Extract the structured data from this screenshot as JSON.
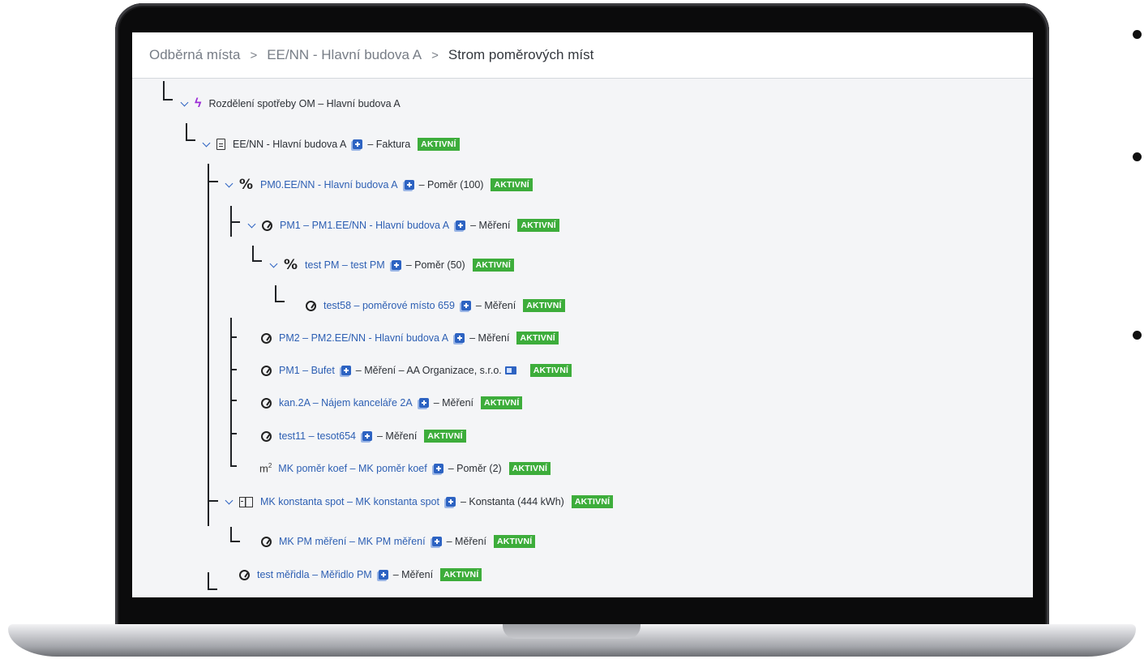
{
  "breadcrumb": [
    {
      "label": "Odběrná místa"
    },
    {
      "label": "EE/NN - Hlavní budova A"
    },
    {
      "label": "Strom poměrových míst"
    }
  ],
  "breadcrumb_separator": ">",
  "status_badge": "AKTIVNÍ",
  "colors": {
    "badge": "#3dad3b",
    "link": "#2d5fb3",
    "bolt": "#9b2bd6",
    "action": "#2d63c2"
  },
  "tree": [
    {
      "label": "Rozdělení spotřeby OM – Hlavní budova A",
      "icon": "bolt-icon",
      "expandable": true
    },
    {
      "label": "EE/NN - Hlavní budova A",
      "icon": "document-icon",
      "expandable": true,
      "suffix": "– Faktura",
      "status": "AKTIVNÍ"
    },
    {
      "label": "PM0.EE/NN - Hlavní budova A",
      "icon": "percent-icon",
      "expandable": true,
      "suffix": "– Poměr (100)",
      "status": "AKTIVNÍ"
    },
    {
      "label": "PM1 – PM1.EE/NN - Hlavní budova A",
      "icon": "gauge-icon",
      "expandable": true,
      "suffix": "– Měření",
      "status": "AKTIVNÍ"
    },
    {
      "label": "test PM – test PM",
      "icon": "percent-icon",
      "expandable": true,
      "suffix": "– Poměr (50)",
      "status": "AKTIVNÍ"
    },
    {
      "label": "test58 – poměrové místo 659",
      "icon": "gauge-icon",
      "suffix": "– Měření",
      "status": "AKTIVNÍ"
    },
    {
      "label": "PM2 – PM2.EE/NN - Hlavní budova A",
      "icon": "gauge-icon",
      "suffix": "– Měření",
      "status": "AKTIVNÍ"
    },
    {
      "label": "PM1 – Bufet",
      "icon": "gauge-icon",
      "suffix": "– Měření – AA Organizace, s.r.o.",
      "status": "AKTIVNÍ"
    },
    {
      "label": "kan.2A – Nájem kanceláře 2A",
      "icon": "gauge-icon",
      "suffix": "– Měření",
      "status": "AKTIVNÍ"
    },
    {
      "label": "test11 – tesot654",
      "icon": "gauge-icon",
      "suffix": "– Měření",
      "status": "AKTIVNÍ"
    },
    {
      "label": "MK poměr koef – MK poměr koef",
      "icon_text": "m",
      "icon_sup": "2",
      "suffix": "– Poměr (2)",
      "status": "AKTIVNÍ"
    },
    {
      "label": "MK konstanta spot – MK konstanta spot",
      "icon": "calculator-icon",
      "expandable": true,
      "suffix": "– Konstanta (444 kWh)",
      "status": "AKTIVNÍ"
    },
    {
      "label": "MK PM měření – MK PM měření",
      "icon": "gauge-icon",
      "suffix": "– Měření",
      "status": "AKTIVNÍ"
    },
    {
      "label": "test měřidla – Měřidlo PM",
      "icon": "gauge-icon",
      "suffix": "– Měření",
      "status": "AKTIVNÍ"
    }
  ]
}
